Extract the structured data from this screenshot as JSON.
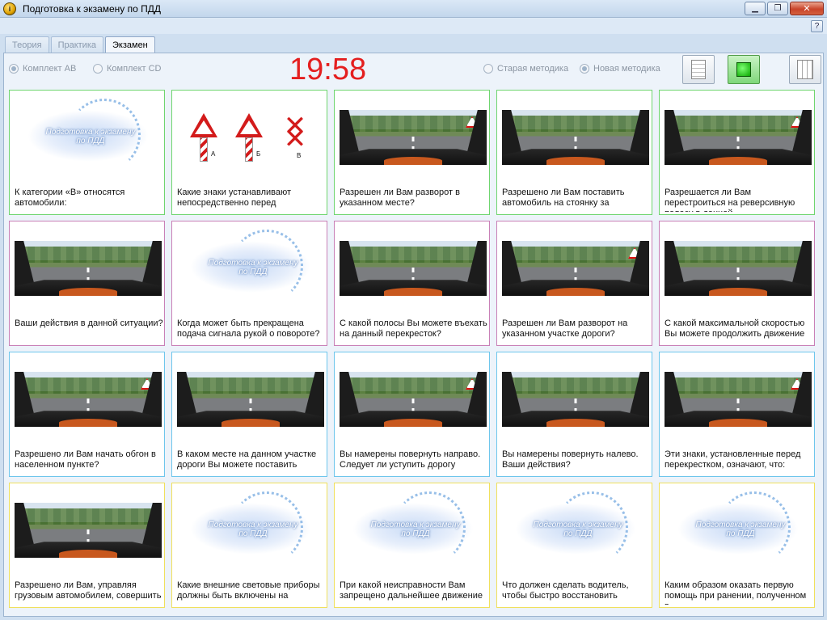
{
  "window": {
    "title": "Подготовка к экзамену по ПДД",
    "minimize": "▁",
    "maximize": "❐",
    "close": "✕",
    "help": "?"
  },
  "tabs": [
    {
      "label": "Теория",
      "active": false
    },
    {
      "label": "Практика",
      "active": false
    },
    {
      "label": "Экзамен",
      "active": true
    }
  ],
  "options": {
    "set_ab": "Комплект AB",
    "set_cd": "Комплект CD",
    "old_method": "Старая методика",
    "new_method": "Новая методика"
  },
  "timer": "19:58",
  "logo_text": "Подготовка к экзамену по ПДД",
  "sign_letters": [
    "А",
    "Б",
    "В"
  ],
  "questions": [
    {
      "text": "К категории «В» относятся автомобили:",
      "color": "green",
      "thumb": "logo"
    },
    {
      "text": "Какие знаки устанавливают непосредственно перед",
      "color": "green",
      "thumb": "signs"
    },
    {
      "text": "Разрешен ли Вам разворот в указанном месте?",
      "color": "green",
      "thumb": "road"
    },
    {
      "text": "Разрешено ли Вам поставить автомобиль на стоянку за",
      "color": "green",
      "thumb": "road"
    },
    {
      "text": "Разрешается ли Вам перестроиться на реверсивную полосу в данной",
      "color": "green",
      "thumb": "road"
    },
    {
      "text": "Ваши действия в данной ситуации?",
      "color": "pink",
      "thumb": "road"
    },
    {
      "text": "Когда может быть прекращена подача сигнала рукой о повороте?",
      "color": "pink",
      "thumb": "logo"
    },
    {
      "text": "С какой полосы Вы можете въехать на данный перекресток?",
      "color": "pink",
      "thumb": "road"
    },
    {
      "text": "Разрешен ли Вам разворот на указанном участке дороги?",
      "color": "pink",
      "thumb": "road"
    },
    {
      "text": "С какой максимальной скоростью Вы можете продолжить движение",
      "color": "pink",
      "thumb": "road"
    },
    {
      "text": "Разрешено ли Вам начать обгон в населенном пункте?",
      "color": "blue",
      "thumb": "road"
    },
    {
      "text": "В каком месте на данном участке дороги Вы можете поставить",
      "color": "blue",
      "thumb": "road"
    },
    {
      "text": "Вы намерены повернуть направо. Следует ли уступить дорогу",
      "color": "blue",
      "thumb": "road"
    },
    {
      "text": "Вы намерены повернуть налево. Ваши действия?",
      "color": "blue",
      "thumb": "road"
    },
    {
      "text": "Эти знаки, установленные перед перекрестком, означают, что:",
      "color": "blue",
      "thumb": "road"
    },
    {
      "text": "Разрешено ли Вам, управляя грузовым автомобилем, совершить",
      "color": "yellow",
      "thumb": "road"
    },
    {
      "text": "Какие внешние световые приборы должны быть включены на",
      "color": "yellow",
      "thumb": "logo"
    },
    {
      "text": "При какой неисправности Вам запрещено дальнейшее движение",
      "color": "yellow",
      "thumb": "logo"
    },
    {
      "text": "Что должен сделать водитель, чтобы быстро восстановить",
      "color": "yellow",
      "thumb": "logo"
    },
    {
      "text": "Каким образом оказать первую помощь при ранении, полученном в",
      "color": "yellow",
      "thumb": "logo"
    }
  ]
}
